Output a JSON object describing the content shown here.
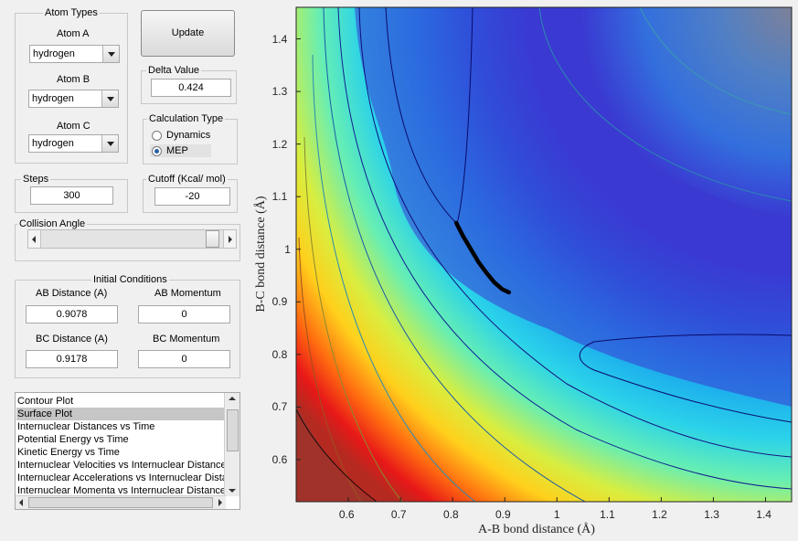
{
  "atom_types": {
    "title": "Atom Types",
    "atom_a": {
      "label": "Atom A",
      "value": "hydrogen"
    },
    "atom_b": {
      "label": "Atom B",
      "value": "hydrogen"
    },
    "atom_c": {
      "label": "Atom C",
      "value": "hydrogen"
    }
  },
  "update_button": "Update",
  "delta": {
    "label": "Delta Value",
    "value": "0.424"
  },
  "calc_type": {
    "label": "Calculation Type",
    "options": [
      "Dynamics",
      "MEP"
    ],
    "selected": "MEP"
  },
  "steps": {
    "label": "Steps",
    "value": "300"
  },
  "cutoff": {
    "label": "Cutoff (Kcal/ mol)",
    "value": "-20"
  },
  "collision_angle": {
    "label": "Collision Angle",
    "value_fraction": 0.97
  },
  "initial_conditions": {
    "title": "Initial Conditions",
    "ab_distance": {
      "label": "AB Distance (A)",
      "value": "0.9078"
    },
    "ab_momentum": {
      "label": "AB Momentum",
      "value": "0"
    },
    "bc_distance": {
      "label": "BC Distance (A)",
      "value": "0.9178"
    },
    "bc_momentum": {
      "label": "BC Momentum",
      "value": "0"
    }
  },
  "plot_list": {
    "items": [
      "Contour Plot",
      "Surface Plot",
      "Internuclear Distances vs Time",
      "Potential Energy vs Time",
      "Kinetic Energy vs Time",
      "Internuclear Velocities vs Internuclear Distances",
      "Internuclear Accelerations vs Internuclear Distances",
      "Internuclear Momenta vs Internuclear Distances"
    ],
    "selected": "Surface Plot"
  },
  "colors": {
    "accent": "#2a5ea0",
    "window_bg": "#f0f0f0"
  },
  "chart_data": {
    "type": "heatmap",
    "title": "",
    "xlabel": "A-B bond distance (Å)",
    "ylabel": "B-C bond distance (Å)",
    "xlim": [
      0.5,
      1.45
    ],
    "ylim": [
      0.52,
      1.46
    ],
    "xticks": [
      "0.6",
      "0.7",
      "0.8",
      "0.9",
      "1",
      "1.1",
      "1.2",
      "1.3",
      "1.4"
    ],
    "yticks": [
      "0.6",
      "0.7",
      "0.8",
      "0.9",
      "1",
      "1.1",
      "1.2",
      "1.3",
      "1.4"
    ],
    "grid": false,
    "colormap": "jet",
    "trajectory": {
      "x": [
        0.807,
        0.82,
        0.835,
        0.85,
        0.865,
        0.88,
        0.895,
        0.908
      ],
      "y": [
        1.05,
        1.025,
        1.0,
        0.975,
        0.955,
        0.937,
        0.924,
        0.918
      ]
    }
  }
}
